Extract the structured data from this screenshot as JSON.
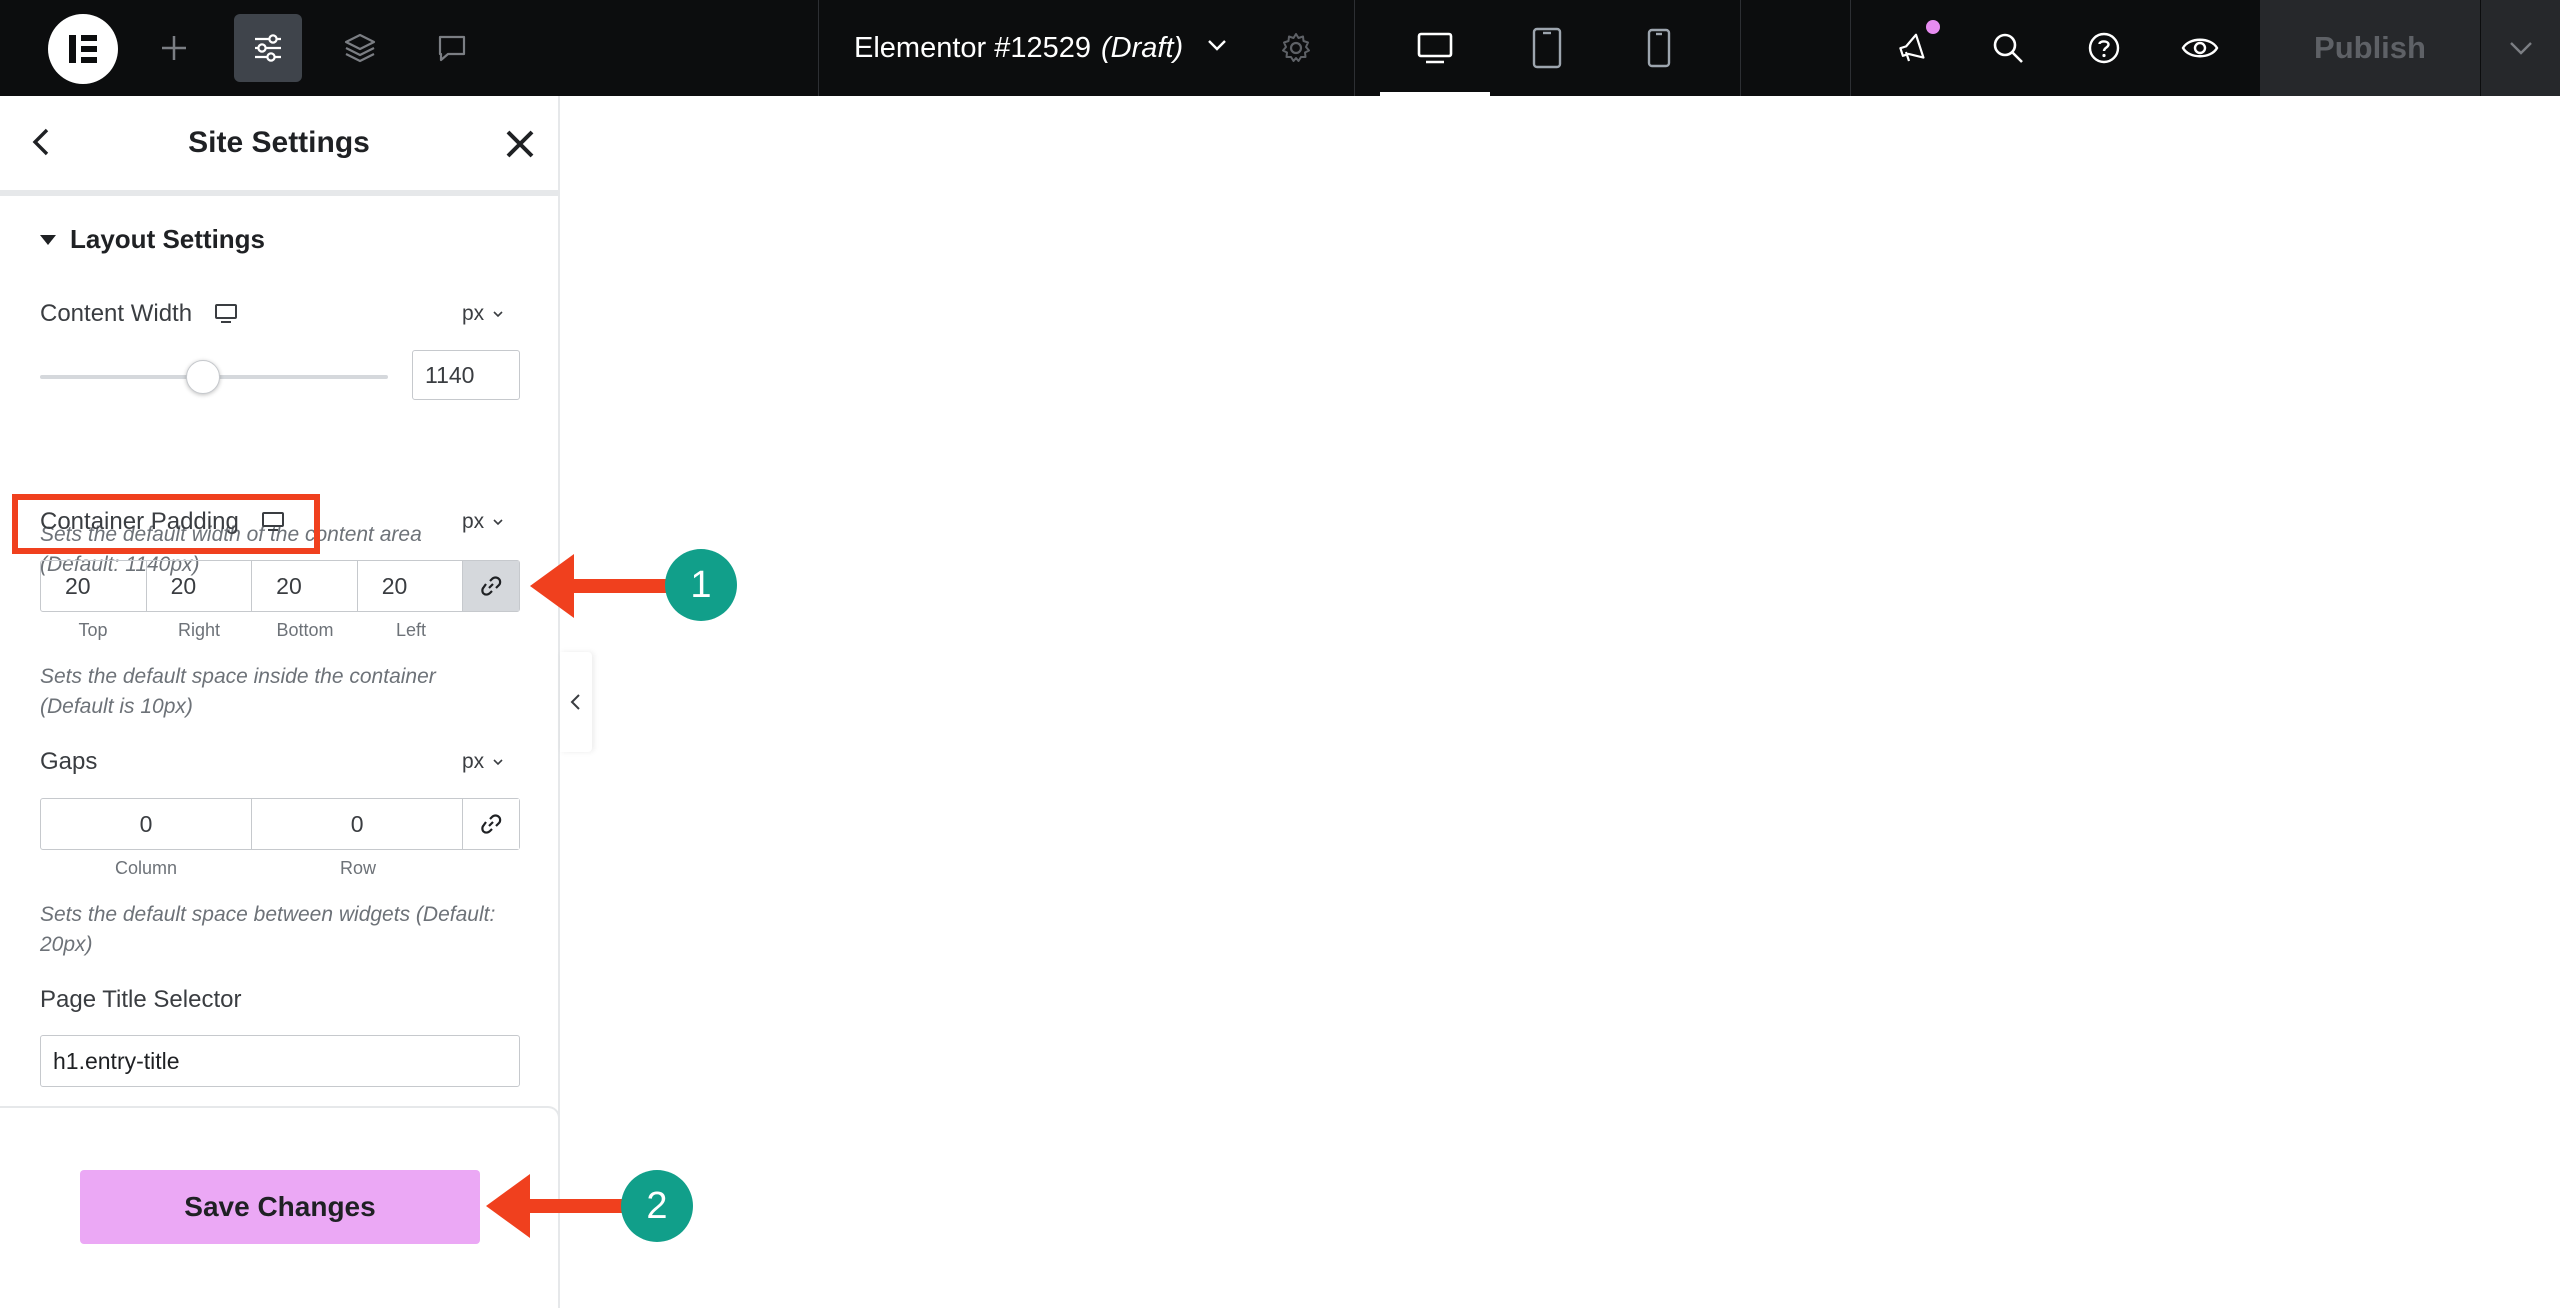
{
  "topbar": {
    "document_title": "Elementor #12529",
    "document_status": "(Draft)",
    "publish_label": "Publish",
    "active_tool": "site-settings",
    "active_device": "desktop"
  },
  "panel": {
    "title": "Site Settings",
    "section_title": "Layout Settings",
    "content_width": {
      "label": "Content Width",
      "unit": "px",
      "value": "1140",
      "slider_fraction": 0.45,
      "help_line1": "Sets the default width of the content area",
      "help_line2": "(Default: 1140px)"
    },
    "container_padding": {
      "label": "Container Padding",
      "unit": "px",
      "values": [
        "20",
        "20",
        "20",
        "20"
      ],
      "labels": [
        "Top",
        "Right",
        "Bottom",
        "Left"
      ],
      "linked": true,
      "help_line1": "Sets the default space inside the container",
      "help_line2": "(Default is 10px)"
    },
    "gaps": {
      "label": "Gaps",
      "unit": "px",
      "values": [
        "0",
        "0"
      ],
      "labels": [
        "Column",
        "Row"
      ],
      "linked": false,
      "help_line1": "Sets the default space between widgets (Default:",
      "help_line2": "20px)"
    },
    "page_title_selector": {
      "label": "Page Title Selector",
      "value": "h1.entry-title"
    },
    "save_label": "Save Changes"
  },
  "annotations": {
    "step1": "1",
    "step2": "2",
    "highlight_color": "#f0401e",
    "badge_color": "#119f8a"
  },
  "colors": {
    "topbar_bg": "#0c0d0e",
    "save_button_bg": "#eba8f5",
    "notification_dot": "#e78cf0"
  }
}
